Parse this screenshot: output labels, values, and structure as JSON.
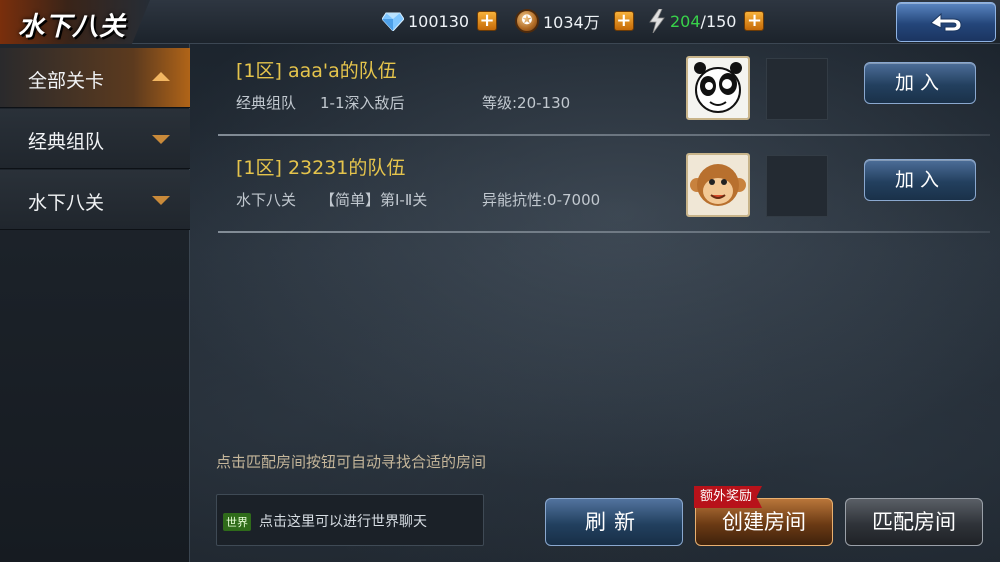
{
  "header": {
    "title": "水下八关",
    "diamonds": "100130",
    "coins": "1034万",
    "energy_current": "204",
    "energy_max": "/150",
    "plus_label": "+"
  },
  "sidebar": {
    "items": [
      {
        "label": "全部关卡",
        "active": true
      },
      {
        "label": "经典组队",
        "active": false
      },
      {
        "label": "水下八关",
        "active": false
      }
    ]
  },
  "rooms": [
    {
      "title": "[1区]  aaa'a的队伍",
      "mode": "经典组队",
      "stage": "1-1深入敌后",
      "requirement": "等级:20-130",
      "avatar": "panda-avatar",
      "join_label": "加入"
    },
    {
      "title": "[1区]  23231的队伍",
      "mode": "水下八关",
      "stage": "【简单】第Ⅰ-Ⅱ关",
      "requirement": "异能抗性:0-7000",
      "avatar": "monkey-avatar",
      "join_label": "加入"
    }
  ],
  "hint": "点击匹配房间按钮可自动寻找合适的房间",
  "chat": {
    "tag": "世界",
    "placeholder": "点击这里可以进行世界聊天"
  },
  "actions": {
    "refresh": "刷新",
    "create": "创建房间",
    "create_badge": "额外奖励",
    "match": "匹配房间"
  },
  "colors": {
    "accent_orange": "#b06418",
    "title_gold": "#e5c44c",
    "energy_green": "#38d24a"
  }
}
